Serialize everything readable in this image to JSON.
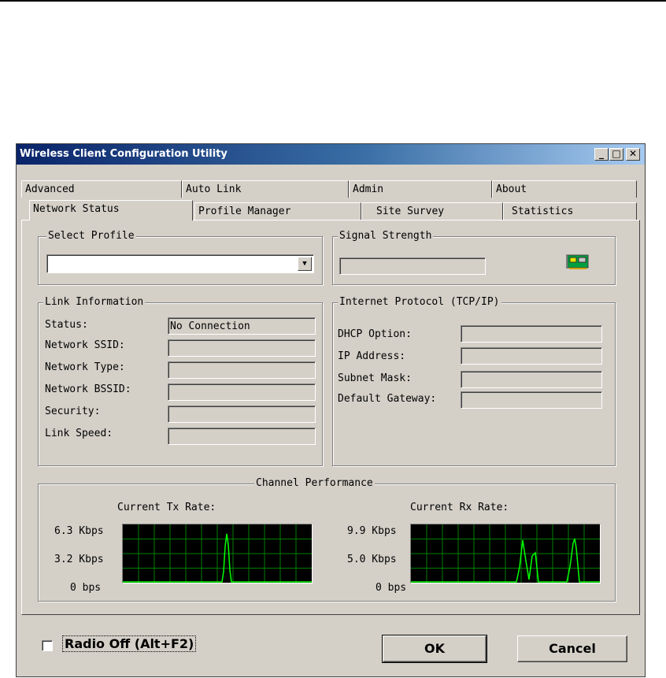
{
  "window": {
    "title": "Wireless Client Configuration Utility"
  },
  "tabs": {
    "back_row": [
      "Advanced",
      "Auto Link",
      "Admin",
      "About"
    ],
    "front_row": [
      "Network Status",
      "Profile Manager",
      "Site Survey",
      "Statistics"
    ],
    "active": "Network Status"
  },
  "select_profile": {
    "legend": "Select Profile",
    "value": ""
  },
  "signal_strength": {
    "legend": "Signal Strength",
    "level_percent": 0
  },
  "link_info": {
    "legend": "Link Information",
    "rows": [
      {
        "label": "Status:",
        "value": "No Connection"
      },
      {
        "label": "Network SSID:",
        "value": ""
      },
      {
        "label": "Network Type:",
        "value": ""
      },
      {
        "label": "Network BSSID:",
        "value": ""
      },
      {
        "label": "Security:",
        "value": ""
      },
      {
        "label": "Link Speed:",
        "value": ""
      }
    ]
  },
  "tcpip": {
    "legend": "Internet Protocol (TCP/IP)",
    "rows": [
      {
        "label": "DHCP Option:",
        "value": ""
      },
      {
        "label": "IP Address:",
        "value": ""
      },
      {
        "label": "Subnet Mask:",
        "value": ""
      },
      {
        "label": "Default Gateway:",
        "value": ""
      }
    ]
  },
  "channel_performance": {
    "legend": "Channel Performance",
    "tx": {
      "title": "Current Tx Rate:",
      "axis": [
        "6.3 Kbps",
        "3.2 Kbps",
        "0 bps"
      ]
    },
    "rx": {
      "title": "Current Rx Rate:",
      "axis": [
        "9.9 Kbps",
        "5.0 Kbps",
        "0 bps"
      ]
    },
    "colors": {
      "grid": "#008000",
      "trace": "#00ff00",
      "background": "#000000"
    }
  },
  "footer": {
    "radio_off_label": "Radio Off (Alt+F2)",
    "radio_off_checked": false,
    "ok_label": "OK",
    "cancel_label": "Cancel"
  }
}
